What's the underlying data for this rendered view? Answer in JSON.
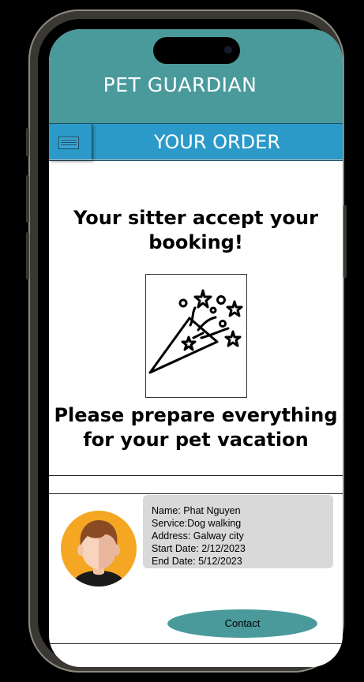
{
  "header": {
    "app_title": "PET GUARDIAN"
  },
  "order_bar": {
    "title": "YOUR ORDER",
    "menu_icon": "menu-icon"
  },
  "main": {
    "headline": "Your sitter accept your booking!",
    "illustration_icon": "party-popper-icon",
    "subheadline": "Please prepare everything for your pet vacation"
  },
  "sitter": {
    "name": "Name: Phat Nguyen",
    "service": "Service:Dog walking",
    "address": "Address: Galway city",
    "start_date": "Start Date: 2/12/2023",
    "end_date": "End Date: 5/12/2023",
    "avatar_icon": "sitter-avatar"
  },
  "actions": {
    "contact_label": "Contact"
  },
  "colors": {
    "header": "#4a9a9b",
    "order_bar": "#2c9ac9",
    "card": "#d9d9d9",
    "avatar_bg": "#f5a623"
  }
}
